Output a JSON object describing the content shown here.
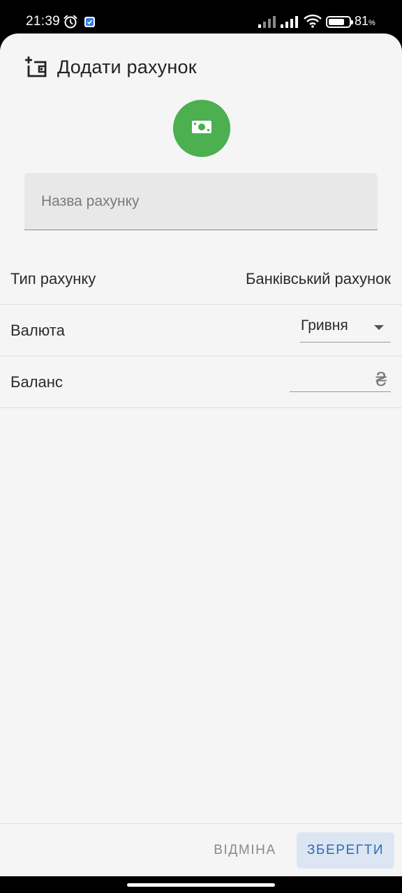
{
  "status_bar": {
    "time": "21:39",
    "battery_percent": "81",
    "battery_unit": "%",
    "battery_level": 0.81,
    "icons": [
      "alarm-icon",
      "app-notification-icon",
      "signal-icon",
      "signal-icon",
      "wifi-icon",
      "battery-icon"
    ]
  },
  "dialog": {
    "title": "Додати рахунок",
    "title_icon": "add-wallet-icon",
    "avatar_icon": "banknote-icon",
    "avatar_color": "#4caf50",
    "name_field": {
      "placeholder": "Назва рахунку",
      "value": ""
    },
    "rows": {
      "type": {
        "label": "Тип рахунку",
        "value": "Банківський рахунок"
      },
      "currency": {
        "label": "Валюта",
        "value": "Гривня"
      },
      "balance": {
        "label": "Баланс",
        "value": "",
        "suffix": "₴"
      }
    },
    "actions": {
      "cancel": "ВІДМІНА",
      "save": "ЗБЕРЕГТИ"
    }
  },
  "colors": {
    "accent": "#2f6ab6",
    "accent_bg": "#dbe6f2",
    "sheet_bg": "#f5f5f5"
  }
}
